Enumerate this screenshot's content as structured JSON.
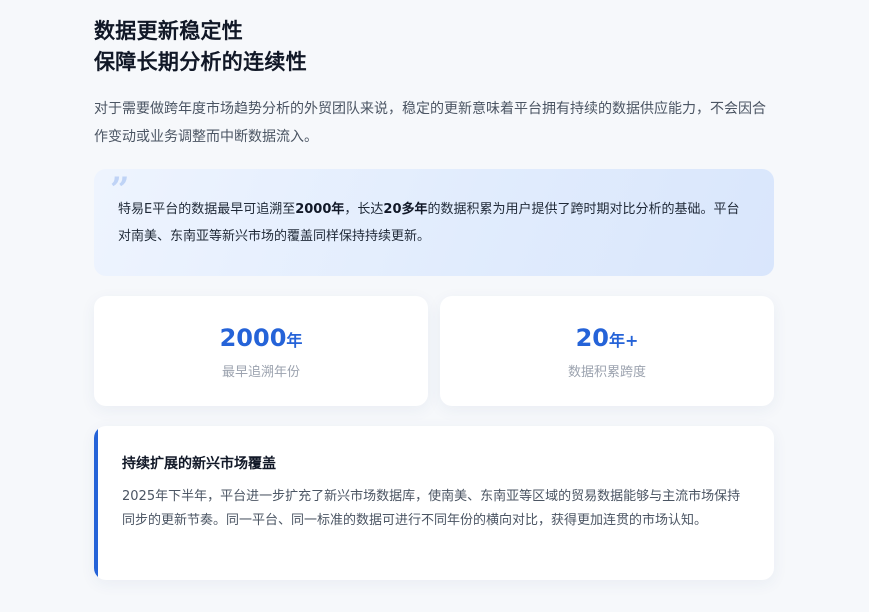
{
  "heading": {
    "line1": "数据更新稳定性",
    "line2": "保障长期分析的连续性"
  },
  "intro": "对于需要做跨年度市场趋势分析的外贸团队来说，稳定的更新意味着平台拥有持续的数据供应能力，不会因合作变动或业务调整而中断数据流入。",
  "quote": {
    "mark": "”",
    "part1": "特易E平台的数据最早可追溯至",
    "bold1": "2000年",
    "part2": "，长达",
    "bold2": "20多年",
    "part3": "的数据积累为用户提供了跨时期对比分析的基础。平台对南美、东南亚等新兴市场的覆盖同样保持持续更新。"
  },
  "stats": [
    {
      "value": "2000",
      "unit": "年",
      "label": "最早追溯年份"
    },
    {
      "value": "20",
      "unit": "年+",
      "label": "数据积累跨度"
    }
  ],
  "info": {
    "title": "持续扩展的新兴市场覆盖",
    "body": "2025年下半年，平台进一步扩充了新兴市场数据库，使南美、东南亚等区域的贸易数据能够与主流市场保持同步的更新节奏。同一平台、同一标准的数据可进行不同年份的横向对比，获得更加连贯的市场认知。"
  },
  "colors": {
    "accent": "#2563d8",
    "quote_bg": "#e1ecfd",
    "page_bg": "#f6f8fb"
  }
}
